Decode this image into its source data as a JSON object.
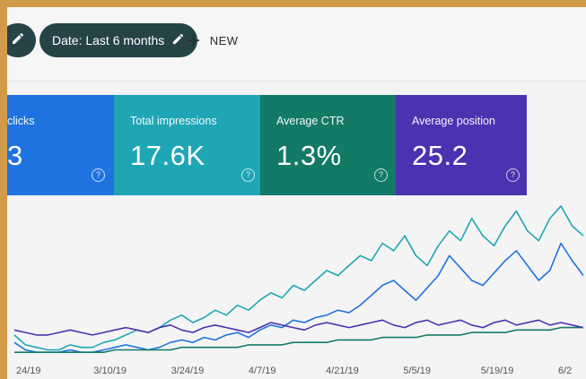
{
  "toolbar": {
    "date_filter_label": "Date: Last 6 months",
    "new_label": "NEW"
  },
  "cards": [
    {
      "label": "clicks",
      "value": "3"
    },
    {
      "label": "Total impressions",
      "value": "17.6K"
    },
    {
      "label": "Average CTR",
      "value": "1.3%"
    },
    {
      "label": "Average position",
      "value": "25.2"
    }
  ],
  "colors": {
    "clicks": "#1e73e0",
    "impressions": "#1ea6b5",
    "ctr": "#127a67",
    "position": "#4a32b0"
  },
  "icons": {
    "edit": "pencil-icon",
    "add": "plus-icon",
    "help": "help-circle-icon"
  },
  "chart_data": {
    "type": "line",
    "x_ticks": [
      "24/19",
      "3/10/19",
      "3/24/19",
      "4/7/19",
      "4/21/19",
      "5/5/19",
      "5/19/19",
      "6/2"
    ],
    "series": [
      {
        "values": [
          5,
          2,
          1,
          1,
          1,
          2,
          1,
          1,
          2,
          3,
          4,
          3,
          2,
          3,
          5,
          6,
          5,
          7,
          6,
          8,
          9,
          7,
          10,
          12,
          11,
          14,
          13,
          15,
          16,
          18,
          17,
          20,
          24,
          28,
          30,
          26,
          22,
          27,
          32,
          40,
          35,
          30,
          28,
          33,
          38,
          42,
          36,
          30,
          34,
          45,
          38,
          32
        ]
      },
      {
        "values": [
          8,
          4,
          3,
          2,
          2,
          4,
          3,
          3,
          5,
          6,
          8,
          10,
          9,
          11,
          14,
          16,
          13,
          15,
          18,
          16,
          20,
          18,
          22,
          25,
          23,
          28,
          26,
          30,
          34,
          32,
          36,
          40,
          38,
          45,
          42,
          48,
          40,
          36,
          44,
          50,
          46,
          55,
          48,
          44,
          52,
          58,
          50,
          46,
          55,
          60,
          52,
          48
        ]
      },
      {
        "values": [
          1,
          1,
          1,
          1,
          1,
          1,
          1,
          1,
          1,
          2,
          2,
          2,
          2,
          2,
          2,
          3,
          3,
          3,
          3,
          3,
          3,
          4,
          4,
          4,
          4,
          5,
          5,
          5,
          5,
          6,
          6,
          6,
          6,
          7,
          7,
          7,
          7,
          8,
          8,
          8,
          8,
          9,
          9,
          9,
          9,
          10,
          10,
          10,
          10,
          11,
          11,
          11
        ]
      },
      {
        "values": [
          10,
          9,
          8,
          8,
          9,
          10,
          9,
          8,
          9,
          10,
          11,
          10,
          9,
          11,
          12,
          10,
          9,
          11,
          12,
          11,
          10,
          9,
          11,
          13,
          12,
          11,
          10,
          12,
          13,
          12,
          11,
          12,
          13,
          14,
          12,
          11,
          13,
          14,
          12,
          13,
          14,
          12,
          11,
          13,
          14,
          12,
          13,
          14,
          12,
          13,
          12,
          11
        ]
      }
    ]
  }
}
